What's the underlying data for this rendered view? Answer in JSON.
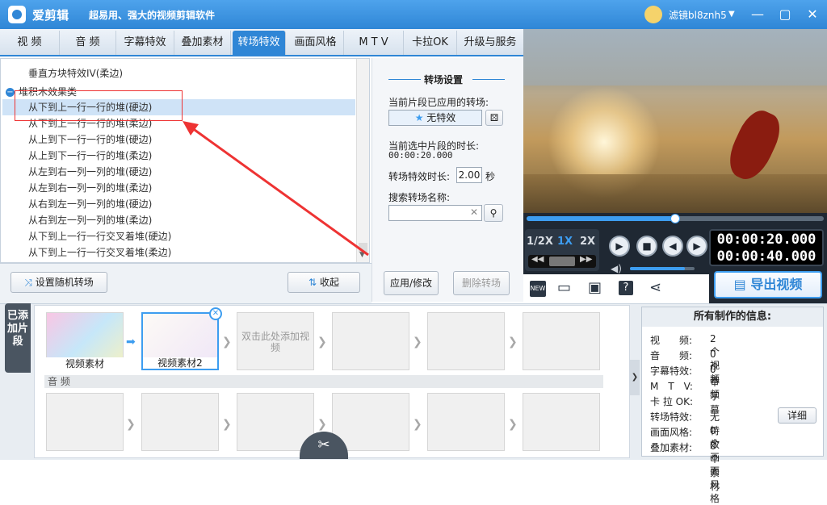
{
  "app": {
    "name": "爱剪辑",
    "slogan": "超易用、强大的视频剪辑软件",
    "user": "滤镜bl8znh5"
  },
  "tabs": [
    "视 频",
    "音 频",
    "字幕特效",
    "叠加素材",
    "转场特效",
    "画面风格",
    "M T V",
    "卡拉OK",
    "升级与服务"
  ],
  "list": {
    "partial": "垂直方块特效IV(柔边)",
    "group": "堆积木效果类",
    "items": [
      "从下到上一行一行的堆(硬边)",
      "从下到上一行一行的堆(柔边)",
      "从上到下一行一行的堆(硬边)",
      "从上到下一行一行的堆(柔边)",
      "从左到右一列一列的堆(硬边)",
      "从左到右一列一列的堆(柔边)",
      "从右到左一列一列的堆(硬边)",
      "从右到左一列一列的堆(柔边)",
      "从下到上一行一行交叉着堆(硬边)",
      "从下到上一行一行交叉着堆(柔边)"
    ]
  },
  "leftbuttons": {
    "random": "设置随机转场",
    "collapse": "收起"
  },
  "settings": {
    "title": "转场设置",
    "applied_label": "当前片段已应用的转场:",
    "applied_value": "无特效",
    "duration_label": "当前选中片段的时长:",
    "duration_value": "00:00:20.000",
    "effect_duration_label": "转场特效时长:",
    "effect_duration_value": "2.00",
    "sec": "秒",
    "search_label": "搜索转场名称:",
    "apply_btn": "应用/修改",
    "delete_btn": "删除转场"
  },
  "player": {
    "time_current": "00:00:20.000",
    "time_total": "00:00:40.000",
    "speeds": [
      "1/2X",
      "1X",
      "2X"
    ],
    "progress": 0.5,
    "volume": 0.85
  },
  "export": "导出视频",
  "sidetab": "已添加片段",
  "clips": {
    "clip1": "视频素材",
    "clip2": "视频素材2",
    "add_hint": "双击此处添加视频",
    "audio_label": "音 频"
  },
  "info": {
    "title": "所有制作的信息:",
    "rows": [
      [
        "视　　频:",
        "2个视频"
      ],
      [
        "音　　频:",
        "0个音频"
      ],
      [
        "字幕特效:",
        "0个字幕"
      ],
      [
        "M　T　V:",
        ""
      ],
      [
        "卡 拉 OK:",
        ""
      ],
      [
        "转场特效:",
        "无特效"
      ],
      [
        "画面风格:",
        "0个画面风格"
      ],
      [
        "叠加素材:",
        "0个素材"
      ]
    ],
    "detail": "详细"
  },
  "colors": {
    "accent": "#2f86d6",
    "highlight": "#cfe3f7",
    "annotation": "#e33333"
  }
}
